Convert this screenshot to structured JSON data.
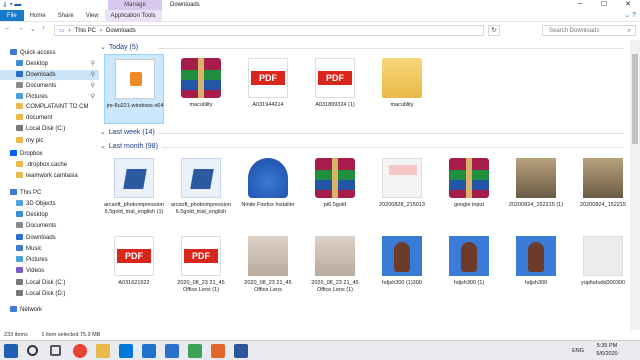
{
  "title_bar": {
    "manage_tab": "Manage",
    "title": "Downloads",
    "quick_access_icons": [
      "down-arrow-icon",
      "save-icon",
      "folder-icon"
    ],
    "controls": [
      "─",
      "☐",
      "✕"
    ]
  },
  "ribbon": {
    "tabs": [
      "File",
      "Home",
      "Share",
      "View",
      "Application Tools"
    ],
    "collapse_glyph": "⌄ ?"
  },
  "address": {
    "crumbs": [
      "This PC",
      "Downloads"
    ],
    "separator": "›",
    "search_placeholder": "Search Downloads"
  },
  "sidebar": {
    "items": [
      {
        "label": "Quick access",
        "icon": "star-icon",
        "level": 0
      },
      {
        "label": "Desktop",
        "icon": "desktop-icon",
        "level": 1,
        "pinned": true
      },
      {
        "label": "Downloads",
        "icon": "download-icon",
        "level": 1,
        "pinned": true,
        "selected": true
      },
      {
        "label": "Documents",
        "icon": "documents-icon",
        "level": 1,
        "pinned": true
      },
      {
        "label": "Pictures",
        "icon": "pictures-icon",
        "level": 1,
        "pinned": true
      },
      {
        "label": "COMPLATAINT TO CM",
        "icon": "folder-icon",
        "level": 1
      },
      {
        "label": "document",
        "icon": "folder-icon",
        "level": 1
      },
      {
        "label": "Local Disk (C:)",
        "icon": "drive-icon",
        "level": 1
      },
      {
        "label": "my pic",
        "icon": "folder-icon",
        "level": 1
      },
      {
        "label": "Dropbox",
        "icon": "dropbox-icon",
        "level": 0
      },
      {
        "label": ".dropbox.cache",
        "icon": "folder-icon",
        "level": 1
      },
      {
        "label": "teamwork camtasia",
        "icon": "folder-icon",
        "level": 1
      },
      {
        "label": "This PC",
        "icon": "computer-icon",
        "level": 0
      },
      {
        "label": "3D Objects",
        "icon": "cube-icon",
        "level": 1
      },
      {
        "label": "Desktop",
        "icon": "desktop-icon",
        "level": 1
      },
      {
        "label": "Documents",
        "icon": "documents-icon",
        "level": 1
      },
      {
        "label": "Downloads",
        "icon": "download-icon",
        "level": 1
      },
      {
        "label": "Music",
        "icon": "music-icon",
        "level": 1
      },
      {
        "label": "Pictures",
        "icon": "pictures-icon",
        "level": 1
      },
      {
        "label": "Videos",
        "icon": "video-icon",
        "level": 1
      },
      {
        "label": "Local Disk (C:)",
        "icon": "drive-icon",
        "level": 1
      },
      {
        "label": "Local Disk (D:)",
        "icon": "drive-icon",
        "level": 1
      },
      {
        "label": "Network",
        "icon": "network-icon",
        "level": 0
      }
    ]
  },
  "groups": [
    {
      "title": "Today (5)",
      "files": [
        {
          "name": "jre-8u221-windows-x64",
          "kind": "java",
          "selected": true
        },
        {
          "name": "macutility",
          "kind": "rar"
        },
        {
          "name": "A031944214",
          "kind": "pdf"
        },
        {
          "name": "A031899324 (1)",
          "kind": "pdf"
        },
        {
          "name": "macutility",
          "kind": "folder"
        }
      ]
    },
    {
      "title": "Last week (14)",
      "files": []
    },
    {
      "title": "Last month (98)",
      "files": [
        {
          "name": "arcsoft_photoimpression6.5gold_trial_english (1)",
          "kind": "exe"
        },
        {
          "name": "arcsoft_photoimpression6.5gold_trial_english",
          "kind": "exe"
        },
        {
          "name": "Ninite Firefox Installer",
          "kind": "firefox"
        },
        {
          "name": "pi6.5gold",
          "kind": "rar"
        },
        {
          "name": "20200828_215013",
          "kind": "doc"
        },
        {
          "name": "google input",
          "kind": "rar"
        },
        {
          "name": "20200824_152215 (1)",
          "kind": "photo"
        },
        {
          "name": "20200824_152215",
          "kind": "photo"
        },
        {
          "name": "A031621922",
          "kind": "pdf"
        },
        {
          "name": "2020_08_23 21_45 Office Lens (1)",
          "kind": "pdf"
        },
        {
          "name": "2020_08_23 21_45 Office Lens",
          "kind": "scan"
        },
        {
          "name": "2020_08_23 21_45 Office Lens (1)",
          "kind": "scan"
        },
        {
          "name": "hdjsh300 (1)300",
          "kind": "portrait"
        },
        {
          "name": "hdjsh300 (1)",
          "kind": "portrait"
        },
        {
          "name": "hdjsh300",
          "kind": "portrait"
        },
        {
          "name": "yupfududd300300",
          "kind": "stub"
        }
      ]
    }
  ],
  "pdf_badge": "PDF",
  "status": {
    "count": "233 items",
    "selection": "1 item selected  75.9 MB"
  },
  "taskbar": {
    "icons": [
      "start-icon",
      "search-icon",
      "task-view-icon",
      "chrome-icon",
      "file-explorer-icon",
      "edge-icon",
      "mail-icon",
      "store-icon",
      "camtasia-icon",
      "camtasia-recorder-icon",
      "word-icon"
    ],
    "lang": "ENG",
    "time": "5:35 PM",
    "date": "9/6/2020"
  },
  "colors": {
    "accent": "#1979ca",
    "selection": "#cce8ff",
    "manage_tab": "#d9c8ee"
  }
}
